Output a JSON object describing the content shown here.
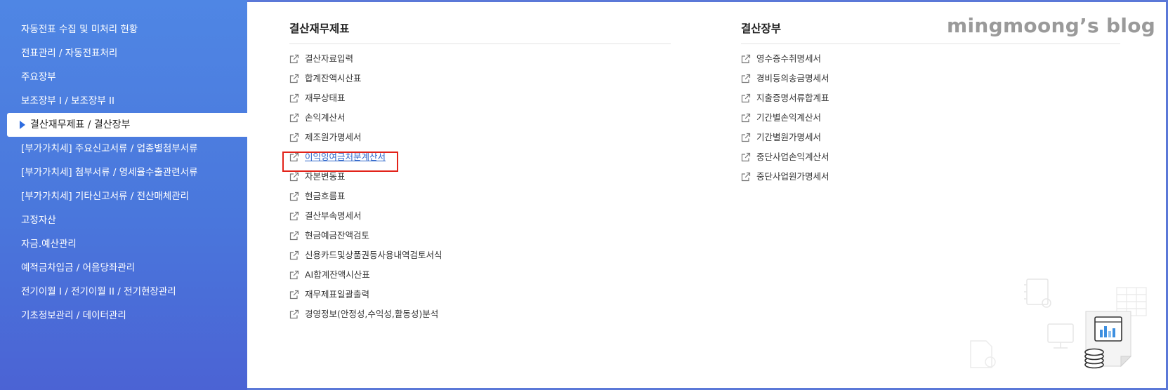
{
  "sidebar": {
    "items": [
      {
        "label": "자동전표 수집 및 미처리 현황"
      },
      {
        "label": "전표관리 / 자동전표처리"
      },
      {
        "label": "주요장부"
      },
      {
        "label": "보조장부 I / 보조장부 II"
      },
      {
        "label": "결산재무제표 / 결산장부",
        "active": true
      },
      {
        "label": "[부가가치세] 주요신고서류 / 업종별첨부서류"
      },
      {
        "label": "[부가가치세] 첨부서류 / 영세율수출관련서류"
      },
      {
        "label": "[부가가치세] 기타신고서류 / 전산매체관리"
      },
      {
        "label": "고정자산"
      },
      {
        "label": "자금.예산관리"
      },
      {
        "label": "예적금차입금 / 어음당좌관리"
      },
      {
        "label": "전기이월 Ⅰ / 전기이월 II / 전기현장관리"
      },
      {
        "label": "기초정보관리 / 데이터관리"
      }
    ]
  },
  "sections": {
    "left": {
      "title": "결산재무제표",
      "links": [
        "결산자료입력",
        "합계잔액시산표",
        "재무상태표",
        "손익계산서",
        "제조원가명세서",
        "이익잉여금처분계산서",
        "자본변동표",
        "현금흐름표",
        "결산부속명세서",
        "현금예금잔액검토",
        "신용카드및상품권등사용내역검토서식",
        "AI합계잔액시산표",
        "재무제표일괄출력",
        "경영정보(안정성,수익성,활동성)분석"
      ],
      "highlighted_index": 5
    },
    "right": {
      "title": "결산장부",
      "links": [
        "영수증수취명세서",
        "경비등의송금명세서",
        "지출증명서류합계표",
        "기간별손익계산서",
        "기간별원가명세서",
        "중단사업손익계산서",
        "중단사업원가명세서"
      ]
    }
  },
  "watermark": "mingmoong’s blog",
  "colors": {
    "sidebar_top": "#4f86e4",
    "sidebar_bottom": "#4b63d4",
    "active_marker": "#2f6de0",
    "highlight_border": "#e2231a",
    "link_highlight": "#2b63c9"
  },
  "icons": {
    "link": "external-link-icon",
    "active": "triangle-right-icon",
    "decor": [
      "chart-document-icon",
      "coins-icon",
      "monitor-icon",
      "notebook-icon",
      "gear-document-icon",
      "table-icon"
    ]
  }
}
